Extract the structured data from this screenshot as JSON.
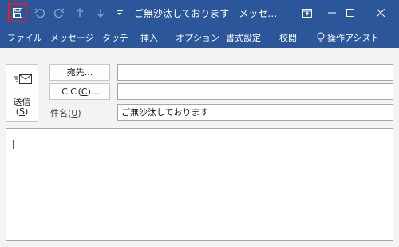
{
  "window": {
    "title": "ご無沙汰しております - メッセ…"
  },
  "ribbon": {
    "tabs": [
      {
        "label": "ファイル"
      },
      {
        "label": "メッセージ"
      },
      {
        "label": "タッチ"
      },
      {
        "label": "挿入"
      },
      {
        "label": "オプション"
      },
      {
        "label": "書式設定"
      },
      {
        "label": "校閲"
      },
      {
        "label": "操作アシスト"
      }
    ]
  },
  "compose": {
    "send_label": "送信",
    "send_key": "S",
    "to_label": "宛先...",
    "cc_label_prefix": "ＣＣ(",
    "cc_key": "C",
    "cc_label_suffix": ")...",
    "to_value": "",
    "cc_value": "",
    "subject_label_prefix": "件名(",
    "subject_key": "U",
    "subject_label_suffix": ")",
    "subject_value": "ご無沙汰しております",
    "body_value": ""
  },
  "colors": {
    "titlebar": "#2b579a",
    "save_highlight": "#e02020"
  },
  "icons": [
    "save-icon",
    "undo-icon",
    "redo-icon",
    "up-icon",
    "down-icon",
    "customize-icon",
    "ribbon-display-icon",
    "minimize-icon",
    "maximize-icon",
    "close-icon",
    "lightbulb-icon",
    "send-envelope-icon"
  ]
}
